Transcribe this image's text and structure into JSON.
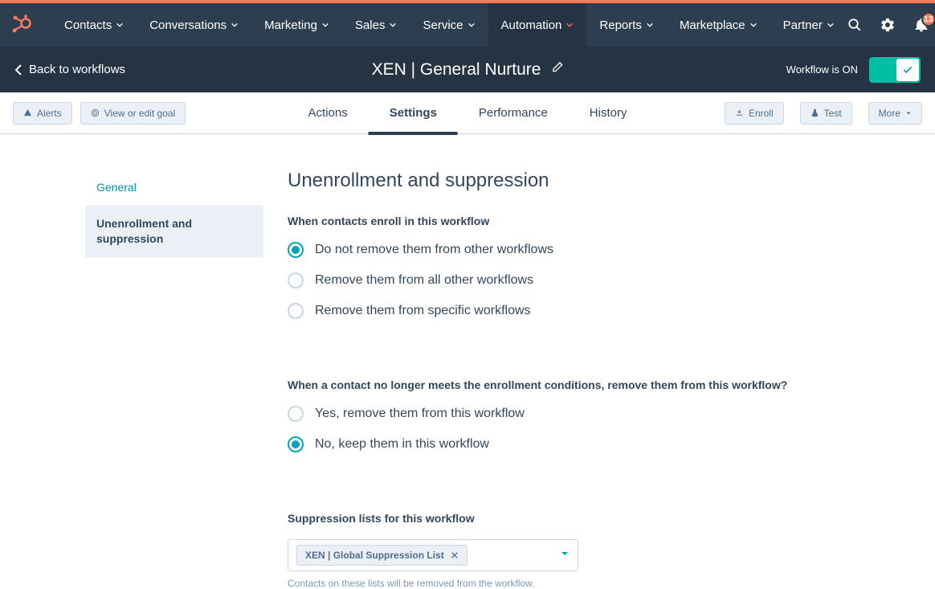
{
  "nav": {
    "items": [
      "Contacts",
      "Conversations",
      "Marketing",
      "Sales",
      "Service",
      "Automation",
      "Reports",
      "Marketplace",
      "Partner"
    ],
    "activeIndex": 5,
    "notificationCount": "13"
  },
  "subheader": {
    "back": "Back to workflows",
    "title": "XEN | General Nurture",
    "statusText": "Workflow is ON"
  },
  "actionBar": {
    "alerts": "Alerts",
    "goal": "View or edit goal",
    "tabs": [
      "Actions",
      "Settings",
      "Performance",
      "History"
    ],
    "activeTab": 1,
    "enroll": "Enroll",
    "test": "Test",
    "more": "More"
  },
  "sidebar": {
    "general": "General",
    "unenroll": "Unenrollment and suppression"
  },
  "main": {
    "heading": "Unenrollment and suppression",
    "q1": "When contacts enroll in this workflow",
    "q1_options": [
      "Do not remove them from other workflows",
      "Remove them from all other workflows",
      "Remove them from specific workflows"
    ],
    "q1_selected": 0,
    "q2": "When a contact no longer meets the enrollment conditions, remove them from this workflow?",
    "q2_options": [
      "Yes, remove them from this workflow",
      "No, keep them in this workflow"
    ],
    "q2_selected": 1,
    "suppression_label": "Suppression lists for this workflow",
    "suppression_chip": "XEN | Global Suppression List",
    "suppression_help": "Contacts on these lists will be removed from the workflow."
  }
}
